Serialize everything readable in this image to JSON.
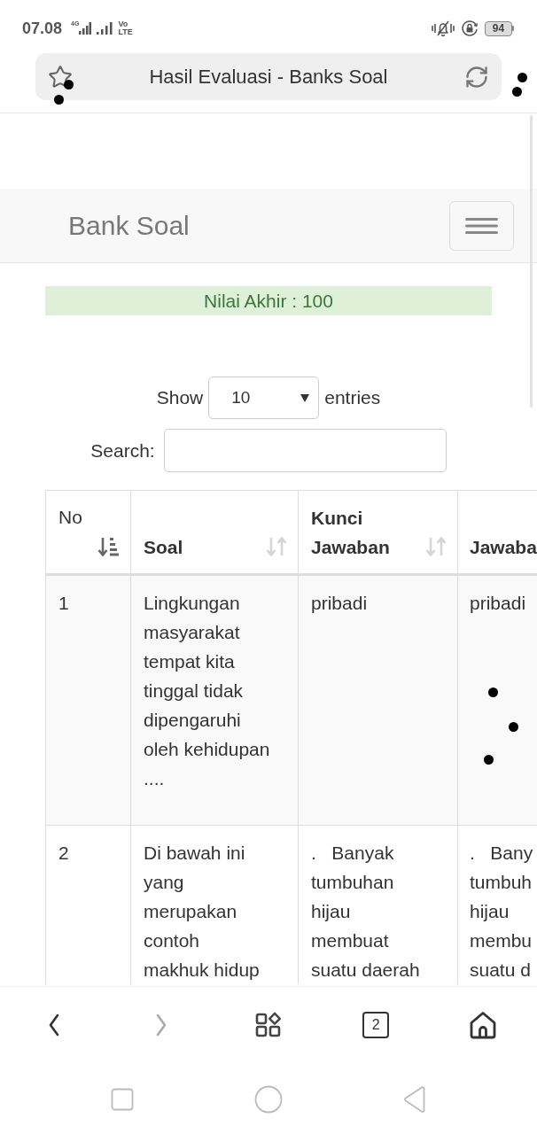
{
  "status_bar": {
    "time": "07.08",
    "network_type": "4G",
    "volte_top": "Vo",
    "volte_bottom": "LTE",
    "battery": "94"
  },
  "browser": {
    "title": "Hasil Evaluasi - Banks Soal"
  },
  "navbar": {
    "brand": "Bank Soal"
  },
  "alert": {
    "text": "Nilai Akhir : 100"
  },
  "length_menu": {
    "label_before": "Show",
    "value": "10",
    "label_after": "entries"
  },
  "search": {
    "label": "Search:"
  },
  "table": {
    "columns": [
      {
        "label": "No",
        "sorted": true
      },
      {
        "label": "Soal",
        "sorted": false
      },
      {
        "label": "Kunci\nJawaban",
        "sorted": false
      },
      {
        "label": "Jawaba"
      }
    ],
    "rows": [
      {
        "cells": [
          "1",
          "Lingkungan\nmasyarakat\ntempat kita\ntinggal tidak\ndipengaruhi\noleh kehidupan\n....",
          "pribadi",
          "pribadi"
        ]
      },
      {
        "cells": [
          "2",
          "Di bawah ini\nyang\nmerupakan\ncontoh\nmakhuk hidup",
          ".   Banyak\ntumbuhan\nhijau\nmembuat\nsuatu daerah",
          ".   Bany\ntumbuh\nhijau\nmembu\nsuatu d"
        ]
      }
    ]
  },
  "toolbar": [
    {
      "kind": "back",
      "disabled": false
    },
    {
      "kind": "forward",
      "disabled": true
    },
    {
      "kind": "apps"
    },
    {
      "kind": "tabs",
      "count": "2"
    },
    {
      "kind": "home"
    }
  ],
  "system_nav": [
    {
      "kind": "recents"
    },
    {
      "kind": "home"
    },
    {
      "kind": "back"
    }
  ]
}
